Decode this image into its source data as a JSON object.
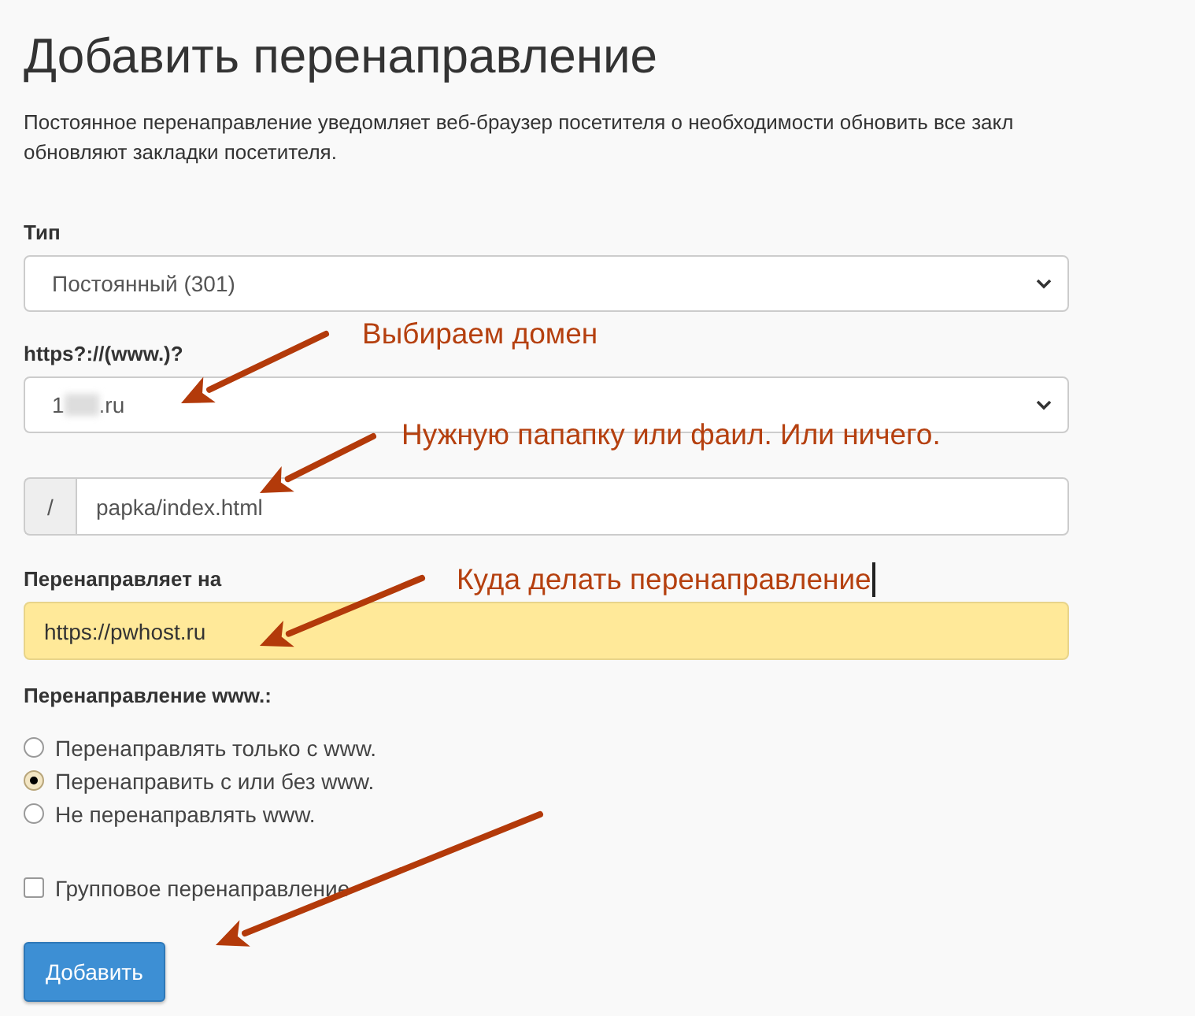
{
  "title": "Добавить перенаправление",
  "description_lines": [
    "Постоянное перенаправление уведомляет веб-браузер посетителя о необходимости обновить все закл",
    "обновляют закладки посетителя."
  ],
  "type_field": {
    "label": "Тип",
    "value": "Постоянный (301)"
  },
  "domain_field": {
    "label": "https?://(www.)?",
    "prefix": "1",
    "suffix": ".ru",
    "redacted": true
  },
  "path_field": {
    "addon": "/",
    "value": "papka/index.html"
  },
  "target_field": {
    "label": "Перенаправляет на",
    "value": "https://pwhost.ru",
    "highlighted": true
  },
  "www_redirect": {
    "label": "Перенаправление www.:",
    "options": [
      {
        "label": "Перенаправлять только с www.",
        "selected": false
      },
      {
        "label": "Перенаправить с или без www.",
        "selected": true
      },
      {
        "label": "Не перенаправлять www.",
        "selected": false
      }
    ]
  },
  "wildcard": {
    "label": "Групповое перенаправление",
    "checked": false
  },
  "submit_button": "Добавить",
  "annotations": [
    {
      "text": "Выбираем домен",
      "cursor": false
    },
    {
      "text": "Нужную папапку или фаил. Или ничего.",
      "cursor": false
    },
    {
      "text": "Куда делать перенаправление",
      "cursor": true
    }
  ]
}
